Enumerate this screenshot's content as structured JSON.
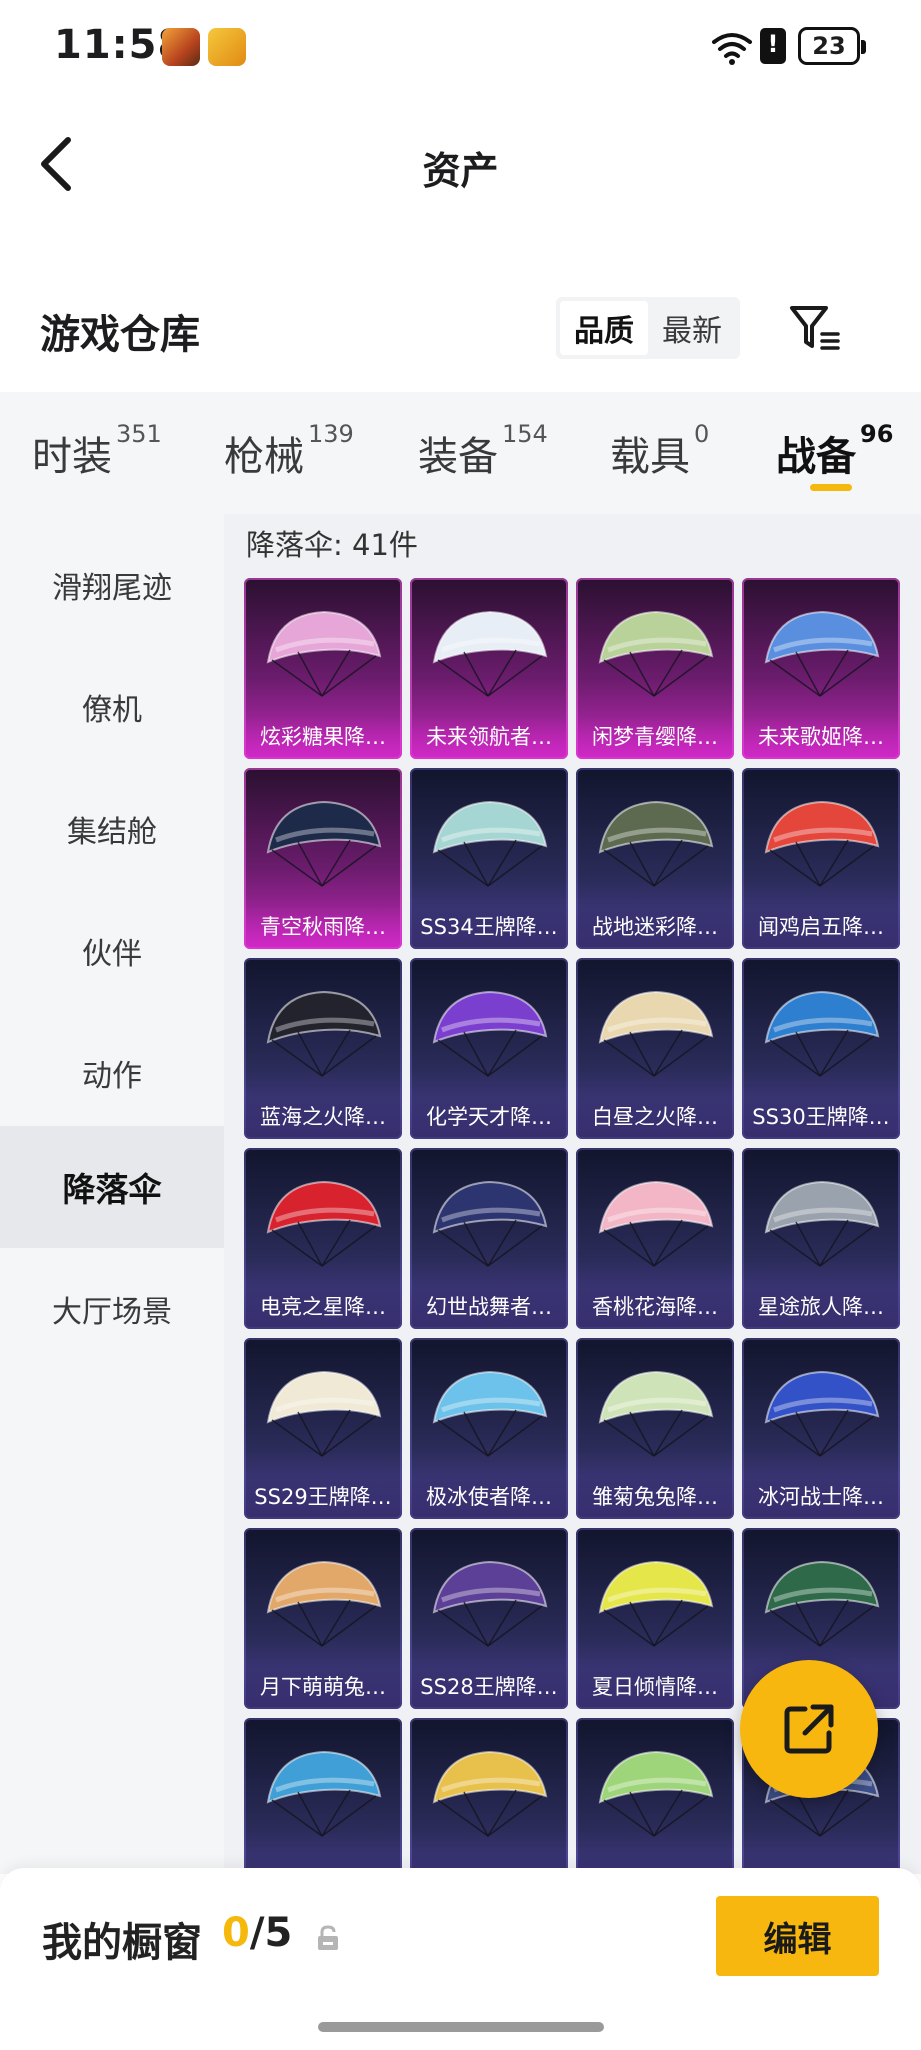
{
  "status_bar": {
    "time": "11:58",
    "battery": "23"
  },
  "nav": {
    "title": "资产"
  },
  "section": {
    "title": "游戏仓库"
  },
  "sort": {
    "options": [
      "品质",
      "最新"
    ],
    "active": 0
  },
  "tabs": [
    {
      "label": "时装",
      "count": "351"
    },
    {
      "label": "枪械",
      "count": "139"
    },
    {
      "label": "装备",
      "count": "154"
    },
    {
      "label": "载具",
      "count": "0"
    },
    {
      "label": "战备",
      "count": "96"
    }
  ],
  "sidebar": {
    "items": [
      "滑翔尾迹",
      "僚机",
      "集结舱",
      "伙伴",
      "动作",
      "降落伞",
      "大厅场景"
    ],
    "active": 5
  },
  "grid": {
    "count_label": "降落伞: 41件",
    "items": [
      {
        "name": "炫彩糖果降…",
        "tier": "legend",
        "color": "#e6a6d8"
      },
      {
        "name": "未来领航者…",
        "tier": "legend",
        "color": "#e8eef6"
      },
      {
        "name": "闲梦青缨降…",
        "tier": "legend",
        "color": "#b9d29a"
      },
      {
        "name": "未来歌姬降…",
        "tier": "legend",
        "color": "#5a8fe0"
      },
      {
        "name": "青空秋雨降…",
        "tier": "legend",
        "color": "#1e2a4a"
      },
      {
        "name": "SS34王牌降…",
        "tier": "epic",
        "color": "#a6d6d3"
      },
      {
        "name": "战地迷彩降…",
        "tier": "epic",
        "color": "#5d6a4f"
      },
      {
        "name": "闻鸡启五降…",
        "tier": "epic",
        "color": "#e4463c"
      },
      {
        "name": "蓝海之火降…",
        "tier": "epic",
        "color": "#23232e"
      },
      {
        "name": "化学天才降…",
        "tier": "epic",
        "color": "#7b3fd0"
      },
      {
        "name": "白昼之火降…",
        "tier": "epic",
        "color": "#e9d7b0"
      },
      {
        "name": "SS30王牌降…",
        "tier": "epic",
        "color": "#2e7fd0"
      },
      {
        "name": "电竞之星降…",
        "tier": "epic",
        "color": "#d8232f"
      },
      {
        "name": "幻世战舞者…",
        "tier": "epic",
        "color": "#2c3570"
      },
      {
        "name": "香桃花海降…",
        "tier": "epic",
        "color": "#f3b6c6"
      },
      {
        "name": "星途旅人降…",
        "tier": "epic",
        "color": "#9aa2ad"
      },
      {
        "name": "SS29王牌降…",
        "tier": "epic",
        "color": "#efe9d6"
      },
      {
        "name": "极冰使者降…",
        "tier": "epic",
        "color": "#6cc2ea"
      },
      {
        "name": "雏菊兔兔降…",
        "tier": "epic",
        "color": "#cfe3b9"
      },
      {
        "name": "冰河战士降…",
        "tier": "epic",
        "color": "#3352c8"
      },
      {
        "name": "月下萌萌兔…",
        "tier": "epic",
        "color": "#e2a86a"
      },
      {
        "name": "SS28王牌降…",
        "tier": "epic",
        "color": "#5c3f96"
      },
      {
        "name": "夏日倾情降…",
        "tier": "epic",
        "color": "#e5e64a"
      },
      {
        "name": "",
        "tier": "epic",
        "color": "#2e6a49"
      },
      {
        "name": "",
        "tier": "epic",
        "color": "#3f9fd6"
      },
      {
        "name": "",
        "tier": "epic",
        "color": "#e8c04c"
      },
      {
        "name": "",
        "tier": "epic",
        "color": "#9fd57a"
      },
      {
        "name": "",
        "tier": "epic",
        "color": "#3d4f8a"
      }
    ]
  },
  "showcase": {
    "title": "我的橱窗",
    "used": "0",
    "separator": "/",
    "max": "5"
  },
  "edit_button": {
    "label": "编辑"
  },
  "colors": {
    "accent": "#f7b70e",
    "legend_card": "#c229b8",
    "epic_card": "#4b3f96"
  }
}
